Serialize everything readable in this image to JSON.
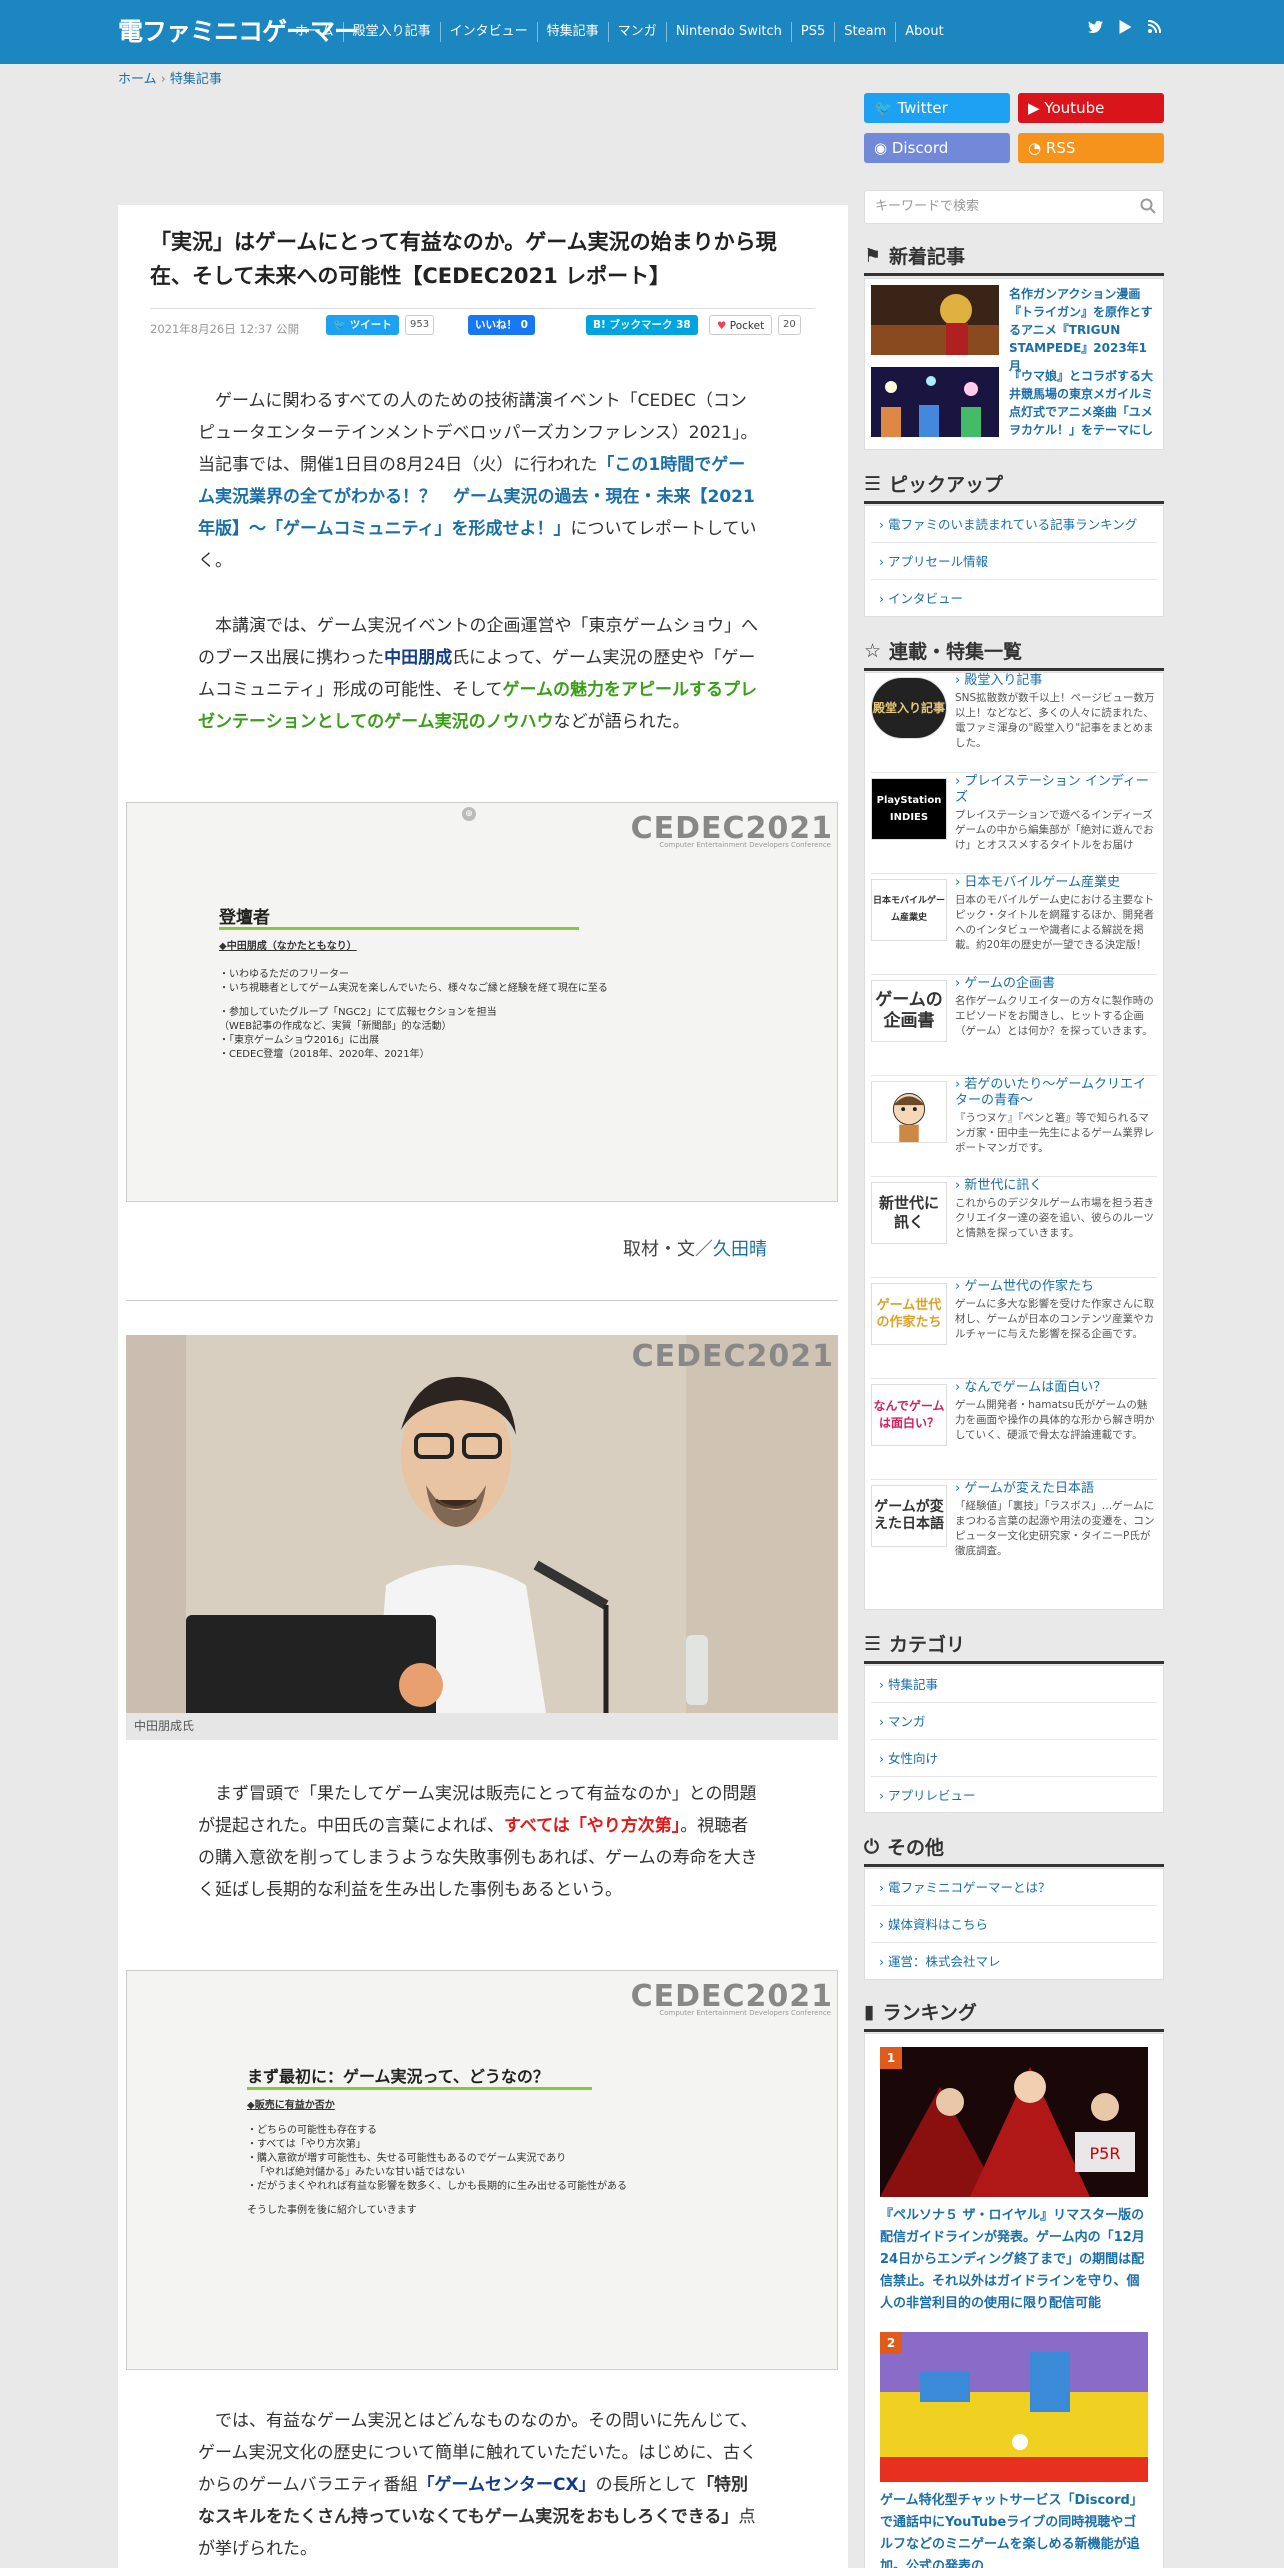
{
  "header": {
    "logo": "電ファミニコゲーマー",
    "nav": [
      "ホーム",
      "殿堂入り記事",
      "インタビュー",
      "特集記事",
      "マンガ",
      "Nintendo Switch",
      "PS5",
      "Steam",
      "About"
    ]
  },
  "breadcrumb": {
    "home": "ホーム",
    "current": "特集記事"
  },
  "article": {
    "title": "「実況」はゲームにとって有益なのか。ゲーム実況の始まりから現在、そして未来への可能性【CEDEC2021 レポート】",
    "date": "2021年8月26日 12:37 公開",
    "share": {
      "tweet": "ツイート",
      "tweet_count": "953",
      "like": "いいね！ 0",
      "hatena": "B! ブックマーク",
      "hatena_count": "38",
      "pocket": "Pocket",
      "pocket_count": "20"
    },
    "p1_a": "ゲームに関わるすべての人のための技術講演イベント「CEDEC（コンピュータエンターテインメントデベロッパーズカンファレンス）2021」。当記事では、開催1日目の8月24日（火）に行われた",
    "p1_link": "「この1時間でゲーム実況業界の全てがわかる！？　ゲーム実況の過去・現在・未来【2021年版】～「ゲームコミュニティ」を形成せよ！」",
    "p1_b": "についてレポートしていく。",
    "p2_a": "本講演では、ゲーム実況イベントの企画運営や「東京ゲームショウ」へのブース出展に携わった",
    "p2_name": "中田朋成",
    "p2_b": "氏によって、ゲーム実況の歴史や「ゲームコミュニティ」形成の可能性、そして",
    "p2_green": "ゲームの魅力をアピールするプレゼンテーションとしてのゲーム実況のノウハウ",
    "p2_c": "などが語られた。",
    "slide1": {
      "logo": "CEDEC2021",
      "logo_sub": "Computer Entertainment Developers Conference",
      "title": "登壇者",
      "name": "◆中田朋成（なかたともなり）",
      "lines": [
        "・いわゆるただのフリーター",
        "・いち視聴者としてゲーム実況を楽しんでいたら、様々なご縁と経験を経て現在に至る",
        "",
        "・参加していたグループ「NGC2」にて広報セクションを担当",
        "（WEB記事の作成など、実質「新聞部」的な活動）",
        "・「東京ゲームショウ2016」に出展",
        "・CEDEC登壇（2018年、2020年、2021年）"
      ]
    },
    "byline_label": "取材・文／",
    "byline_name": "久田晴",
    "photo_logo": "CEDEC2021",
    "photo_caption": "中田朋成氏",
    "p3_a": "まず冒頭で「果たしてゲーム実況は販売にとって有益なのか」との問題が提起された。中田氏の言葉によれば、",
    "p3_red": "すべては「やり方次第」",
    "p3_b": "。視聴者の購入意欲を削ってしまうような失敗事例もあれば、ゲームの寿命を大きく延ばし長期的な利益を生み出した事例もあるという。",
    "slide2": {
      "logo": "CEDEC2021",
      "logo_sub": "Computer Entertainment Developers Conference",
      "title": "まず最初に：ゲーム実況って、どうなの？",
      "name": "◆販売に有益か否か",
      "lines": [
        "・どちらの可能性も存在する",
        "・すべては「やり方次第」",
        "・購入意欲が増す可能性も、失せる可能性もあるのでゲーム実況であり",
        "「やれば絶対儲かる」みたいな甘い話ではない",
        "・だがうまくやれれば有益な影響を数多く、しかも長期的に生み出せる可能性がある",
        "",
        "そうした事例を後に紹介していきます"
      ]
    },
    "p4_a": "では、有益なゲーム実況とはどんなものなのか。その問いに先んじて、ゲーム実況文化の歴史について簡単に触れていただいた。はじめに、古くからのゲームバラエティ番組",
    "p4_navy": "「ゲームセンターCX」",
    "p4_b": "の長所として",
    "p4_bold": "「特別なスキルをたくさん持っていなくてもゲーム実況をおもしろくできる」",
    "p4_c": "点が挙げられた。"
  },
  "sidebar": {
    "social": {
      "twitter": "Twitter",
      "youtube": "Youtube",
      "discord": "Discord",
      "rss": "RSS"
    },
    "search_placeholder": "キーワードで検索",
    "new_heading": "新着記事",
    "new_items": [
      {
        "title": "名作ガンアクション漫画『トライガン』を原作とするアニメ『TRIGUN STAMPEDE』2023年1月"
      },
      {
        "title": "『ウマ娘』とコラボする大井競馬場の東京メガイルミ点灯式でアニメ楽曲「ユメヲカケル！」をテーマにし"
      }
    ],
    "pickup_heading": "ピックアップ",
    "pickup": [
      "電ファミのいま読まれている記事ランキング",
      "アプリセール情報",
      "インタビュー"
    ],
    "series_heading": "連載・特集一覧",
    "series": [
      {
        "thumb": "殿堂入り記事",
        "title": "殿堂入り記事",
        "desc": "SNS拡散数が数千以上！ページビュー数万以上！などなど、多くの人々に読まれた、電ファミ渾身の\"殿堂入り\"記事をまとめました。"
      },
      {
        "thumb": "PlayStation INDIES",
        "title": "プレイステーション インディーズ",
        "desc": "プレイステーションで遊べるインディーズゲームの中から編集部が「絶対に遊んでおけ」とオススメするタイトルをお届け"
      },
      {
        "thumb": "日本モバイルゲーム産業史",
        "title": "日本モバイルゲーム産業史",
        "desc": "日本のモバイルゲーム史における主要なトピック・タイトルを網羅するほか、開発者へのインタビューや識者による解説を掲載。約20年の歴史が一望できる決定版！"
      },
      {
        "thumb": "ゲームの企画書",
        "title": "ゲームの企画書",
        "desc": "名作ゲームクリエイターの方々に製作時のエピソードをお聞きし、ヒットする企画（ゲーム）とは何か？を探っていきます。"
      },
      {
        "thumb": "",
        "title": "若ゲのいたり～ゲームクリエイターの青春～",
        "desc": "『うつヌケ』『ペンと箸』等で知られるマンガ家・田中圭一先生によるゲーム業界レポートマンガです。"
      },
      {
        "thumb": "新世代に訊く",
        "title": "新世代に訊く",
        "desc": "これからのデジタルゲーム市場を担う若きクリエイター達の姿を追い、彼らのルーツと情熱を探っていきます。"
      },
      {
        "thumb": "ゲーム世代の作家たち",
        "title": "ゲーム世代の作家たち",
        "desc": "ゲームに多大な影響を受けた作家さんに取材し、ゲームが日本のコンテンツ産業やカルチャーに与えた影響を探る企画です。"
      },
      {
        "thumb": "なんでゲームは面白い？",
        "title": "なんでゲームは面白い？",
        "desc": "ゲーム開発者・hamatsu氏がゲームの魅力を画面や操作の具体的な形から解き明かしていく、硬派で骨太な評論連載です。"
      },
      {
        "thumb": "ゲームが変えた日本語",
        "title": "ゲームが変えた日本語",
        "desc": "「経験値」「裏技」「ラスボス」…ゲームにまつわる言葉の起源や用法の変遷を、コンピューター文化史研究家・タイニーP氏が徹底調査。"
      }
    ],
    "category_heading": "カテゴリ",
    "categories": [
      "特集記事",
      "マンガ",
      "女性向け",
      "アプリレビュー"
    ],
    "other_heading": "その他",
    "others": [
      "電ファミニコゲーマーとは？",
      "媒体資料はこちら",
      "運営：株式会社マレ"
    ],
    "ranking_heading": "ランキング",
    "ranking": [
      {
        "num": "1",
        "title": "『ペルソナ５ ザ・ロイヤル』リマスター版の配信ガイドラインが発表。ゲーム内の「12月24日からエンディング終了まで」の期間は配信禁止。それ以外はガイドラインを守り、個人の非営利目的の使用に限り配信可能"
      },
      {
        "num": "2",
        "title": "ゲーム特化型チャットサービス「Discord」で通話中にYouTubeライブの同時視聴やゴルフなどのミニゲームを楽しめる新機能が追加。公式の発表の"
      }
    ]
  }
}
